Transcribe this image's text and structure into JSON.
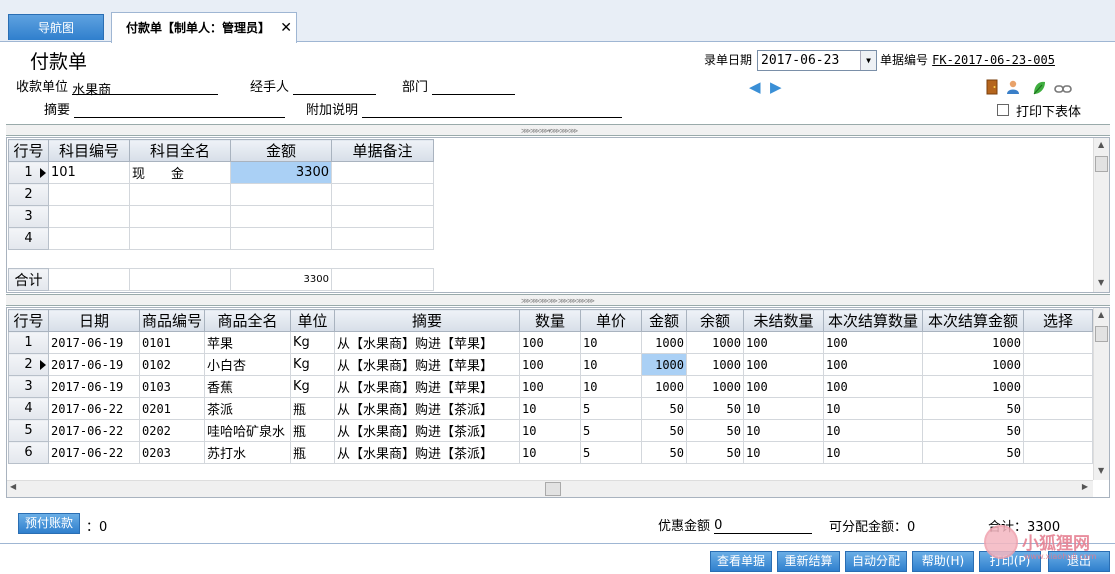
{
  "tabs": {
    "nav": "导航图",
    "active": "付款单【制单人：管理员】",
    "close": "✕"
  },
  "form": {
    "title": "付款单",
    "payee_label": "收款单位",
    "payee_value": "水果商",
    "handler_label": "经手人",
    "dept_label": "部门",
    "summary_label": "摘要",
    "remark_label": "附加说明",
    "date_label": "录单日期",
    "date_value": "2017-06-23",
    "docno_label": "单据编号",
    "docno_value": "FK-2017-06-23-005",
    "print_table_label": "打印下表体"
  },
  "icons": {
    "prev": "arrow-left-icon",
    "next": "arrow-right-icon",
    "door": "door-icon",
    "user": "user-icon",
    "leaf": "leaf-icon",
    "link": "link-icon"
  },
  "accounts_table": {
    "headers": [
      "行号",
      "科目编号",
      "科目全名",
      "金额",
      "单据备注"
    ],
    "rows": [
      {
        "no": "1",
        "code": "101",
        "name": "现　　金",
        "amount": "3300",
        "note": ""
      },
      {
        "no": "2",
        "code": "",
        "name": "",
        "amount": "",
        "note": ""
      },
      {
        "no": "3",
        "code": "",
        "name": "",
        "amount": "",
        "note": ""
      },
      {
        "no": "4",
        "code": "",
        "name": "",
        "amount": "",
        "note": ""
      }
    ],
    "total_label": "合计",
    "total_amount": "3300"
  },
  "items_table": {
    "headers": [
      "行号",
      "日期",
      "商品编号",
      "商品全名",
      "单位",
      "摘要",
      "数量",
      "单价",
      "金额",
      "余额",
      "未结数量",
      "本次结算数量",
      "本次结算金额",
      "选择"
    ],
    "rows": [
      {
        "no": "1",
        "date": "2017-06-19",
        "code": "0101",
        "name": "苹果",
        "unit": "Kg",
        "summary": "从【水果商】购进【苹果】",
        "qty": "100",
        "price": "10",
        "amount": "1000",
        "balance": "1000",
        "unsettled": "100",
        "settle_qty": "100",
        "settle_amt": "1000",
        "pick": ""
      },
      {
        "no": "2",
        "date": "2017-06-19",
        "code": "0102",
        "name": "小白杏",
        "unit": "Kg",
        "summary": "从【水果商】购进【苹果】",
        "qty": "100",
        "price": "10",
        "amount": "1000",
        "balance": "1000",
        "unsettled": "100",
        "settle_qty": "100",
        "settle_amt": "1000",
        "pick": ""
      },
      {
        "no": "3",
        "date": "2017-06-19",
        "code": "0103",
        "name": "香蕉",
        "unit": "Kg",
        "summary": "从【水果商】购进【苹果】",
        "qty": "100",
        "price": "10",
        "amount": "1000",
        "balance": "1000",
        "unsettled": "100",
        "settle_qty": "100",
        "settle_amt": "1000",
        "pick": ""
      },
      {
        "no": "4",
        "date": "2017-06-22",
        "code": "0201",
        "name": "茶派",
        "unit": "瓶",
        "summary": "从【水果商】购进【茶派】",
        "qty": "10",
        "price": "5",
        "amount": "50",
        "balance": "50",
        "unsettled": "10",
        "settle_qty": "10",
        "settle_amt": "50",
        "pick": ""
      },
      {
        "no": "5",
        "date": "2017-06-22",
        "code": "0202",
        "name": "哇哈哈矿泉水",
        "unit": "瓶",
        "summary": "从【水果商】购进【茶派】",
        "qty": "10",
        "price": "5",
        "amount": "50",
        "balance": "50",
        "unsettled": "10",
        "settle_qty": "10",
        "settle_amt": "50",
        "pick": ""
      },
      {
        "no": "6",
        "date": "2017-06-22",
        "code": "0203",
        "name": "苏打水",
        "unit": "瓶",
        "summary": "从【水果商】购进【茶派】",
        "qty": "10",
        "price": "5",
        "amount": "50",
        "balance": "50",
        "unsettled": "10",
        "settle_qty": "10",
        "settle_amt": "50",
        "pick": ""
      }
    ]
  },
  "summary": {
    "prepay_button": "预付账款",
    "prepay_value": "：0",
    "discount_label": "优惠金额",
    "discount_value": "0",
    "allocatable_label": "可分配金额：0",
    "total_label": "合计：3300"
  },
  "buttons": {
    "view": "查看单据",
    "resettle": "重新结算",
    "auto": "自动分配",
    "help": "帮助(H)",
    "print": "打印(P)",
    "exit": "退出"
  },
  "watermark": {
    "text": "小狐狸网",
    "sub": "www.xiaohuli.com"
  },
  "colors": {
    "accent": "#2f7fcd",
    "selected_cell": "#aad0f5"
  }
}
